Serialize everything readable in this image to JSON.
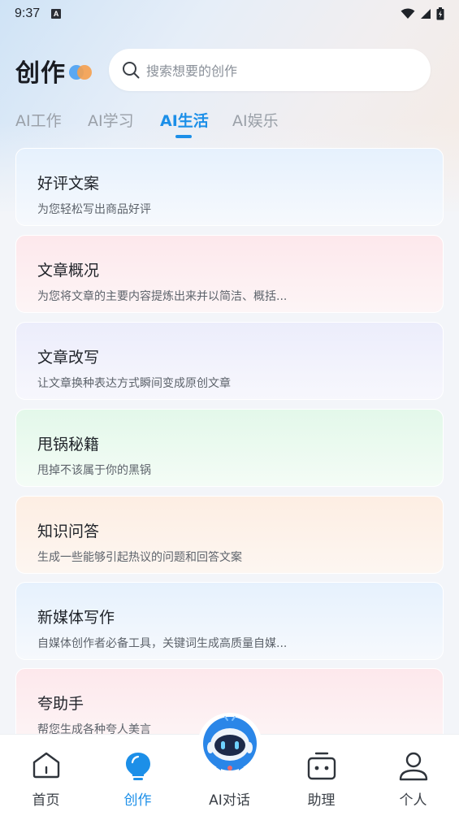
{
  "status_bar": {
    "time": "9:37",
    "notif_badge": "A"
  },
  "header": {
    "title": "创作",
    "search_placeholder": "搜索想要的创作"
  },
  "tabs": [
    {
      "label": "AI工作",
      "active": false
    },
    {
      "label": "AI学习",
      "active": false
    },
    {
      "label": "AI生活",
      "active": true
    },
    {
      "label": "AI娱乐",
      "active": false
    }
  ],
  "cards": [
    {
      "title": "好评文案",
      "desc": "为您轻松写出商品好评"
    },
    {
      "title": "文章概况",
      "desc": "为您将文章的主要内容提炼出来并以简洁、概括..."
    },
    {
      "title": "文章改写",
      "desc": "让文章换种表达方式瞬间变成原创文章"
    },
    {
      "title": "甩锅秘籍",
      "desc": "甩掉不该属于你的黑锅"
    },
    {
      "title": "知识问答",
      "desc": "生成一些能够引起热议的问题和回答文案"
    },
    {
      "title": "新媒体写作",
      "desc": "自媒体创作者必备工具，关键词生成高质量自媒..."
    },
    {
      "title": "夸助手",
      "desc": "帮您生成各种夸人美言"
    }
  ],
  "bottom_nav": [
    {
      "label": "首页",
      "icon": "home-icon",
      "active": false
    },
    {
      "label": "创作",
      "icon": "bulb-icon",
      "active": true
    },
    {
      "label": "AI对话",
      "icon": "robot-icon",
      "active": false
    },
    {
      "label": "助理",
      "icon": "assistant-icon",
      "active": false
    },
    {
      "label": "个人",
      "icon": "person-icon",
      "active": false
    }
  ],
  "colors": {
    "accent": "#1c8fe8",
    "text_primary": "#1f2329",
    "text_secondary": "#5d636b"
  }
}
